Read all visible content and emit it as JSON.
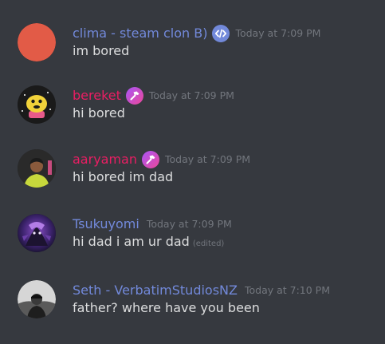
{
  "messages": [
    {
      "username": "clima - steam clon B)",
      "color": "#7289da",
      "badge": "code-icon",
      "timestamp": "Today at 7:09 PM",
      "text": "im bored",
      "avatar": "orange-circle-avatar"
    },
    {
      "username": "bereket",
      "color": "#e91e63",
      "badge": "hammer-icon",
      "timestamp": "Today at 7:09 PM",
      "text": "hi bored",
      "avatar": "yellow-creature-avatar"
    },
    {
      "username": "aaryaman",
      "color": "#e91e63",
      "badge": "hammer-icon",
      "timestamp": "Today at 7:09 PM",
      "text": "hi bored im dad",
      "avatar": "person-avatar"
    },
    {
      "username": "Tsukuyomi",
      "color": "#7289da",
      "timestamp": "Today at 7:09 PM",
      "text": "hi dad i am ur dad",
      "edited": "(edited)",
      "avatar": "purple-art-avatar"
    },
    {
      "username": "Seth - VerbatimStudiosNZ",
      "color": "#7289da",
      "timestamp": "Today at 7:10 PM",
      "text": "father? where have you been",
      "avatar": "bw-photo-avatar"
    }
  ]
}
